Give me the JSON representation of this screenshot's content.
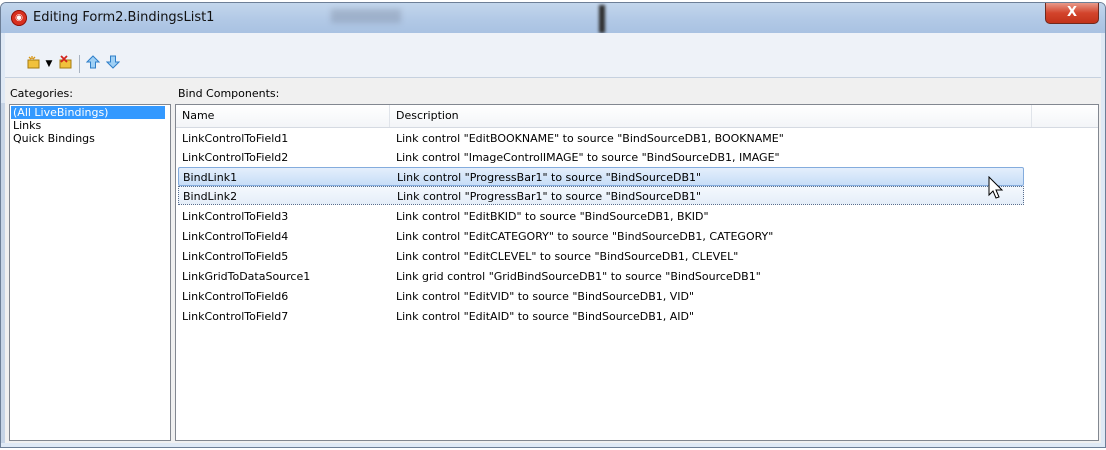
{
  "window": {
    "title": "Editing Form2.BindingsList1",
    "close_glyph": "X"
  },
  "toolbar": {
    "icons": [
      "new-binding-icon",
      "dropdown-arrow-icon",
      "delete-binding-icon",
      "move-up-icon",
      "move-down-icon"
    ]
  },
  "categories": {
    "label": "Categories:",
    "items": [
      "(All LiveBindings)",
      "Links",
      "Quick Bindings"
    ],
    "selected_index": 0
  },
  "bind_components": {
    "label": "Bind Components:",
    "columns": [
      "Name",
      "Description"
    ],
    "rows": [
      {
        "name": "LinkControlToField1",
        "description": "Link control \"EditBOOKNAME\" to source \"BindSourceDB1, BOOKNAME\""
      },
      {
        "name": "LinkControlToField2",
        "description": "Link control \"ImageControlIMAGE\" to source \"BindSourceDB1, IMAGE\""
      },
      {
        "name": "BindLink1",
        "description": "Link control \"ProgressBar1\" to source \"BindSourceDB1\""
      },
      {
        "name": "BindLink2",
        "description": "Link control \"ProgressBar1\" to source \"BindSourceDB1\""
      },
      {
        "name": "LinkControlToField3",
        "description": "Link control \"EditBKID\" to source \"BindSourceDB1, BKID\""
      },
      {
        "name": "LinkControlToField4",
        "description": "Link control \"EditCATEGORY\" to source \"BindSourceDB1, CATEGORY\""
      },
      {
        "name": "LinkControlToField5",
        "description": "Link control \"EditCLEVEL\" to source \"BindSourceDB1, CLEVEL\""
      },
      {
        "name": "LinkGridToDataSource1",
        "description": "Link grid control \"GridBindSourceDB1\" to source \"BindSourceDB1\""
      },
      {
        "name": "LinkControlToField6",
        "description": "Link control \"EditVID\" to source \"BindSourceDB1, VID\""
      },
      {
        "name": "LinkControlToField7",
        "description": "Link control \"EditAID\" to source \"BindSourceDB1, AID\""
      }
    ],
    "selected_index": 2,
    "focused_index": 3
  },
  "colors": {
    "selection": "#3399ff",
    "close_button": "#c9391f"
  }
}
